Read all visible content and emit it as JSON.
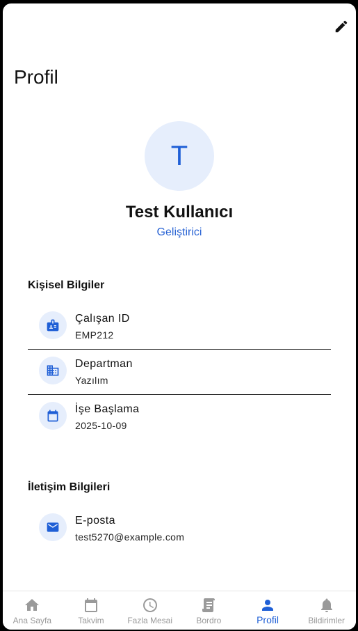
{
  "header": {
    "title": "Profil",
    "edit_icon": "pencil-icon"
  },
  "profile": {
    "avatar_initial": "T",
    "name": "Test Kullanıcı",
    "role": "Geliştirici"
  },
  "personal": {
    "section_title": "Kişisel Bilgiler",
    "items": [
      {
        "icon": "badge-icon",
        "label": "Çalışan ID",
        "value": "EMP212"
      },
      {
        "icon": "building-icon",
        "label": "Departman",
        "value": "Yazılım"
      },
      {
        "icon": "calendar-icon",
        "label": "İşe Başlama",
        "value": "2025-10-09"
      }
    ]
  },
  "contact": {
    "section_title": "İletişim Bilgileri",
    "items": [
      {
        "icon": "mail-icon",
        "label": "E-posta",
        "value": "test5270@example.com"
      }
    ]
  },
  "nav": {
    "items": [
      {
        "icon": "home-icon",
        "label": "Ana Sayfa",
        "active": false
      },
      {
        "icon": "calendar-icon",
        "label": "Takvim",
        "active": false
      },
      {
        "icon": "clock-icon",
        "label": "Fazla Mesai",
        "active": false
      },
      {
        "icon": "receipt-icon",
        "label": "Bordro",
        "active": false
      },
      {
        "icon": "person-icon",
        "label": "Profil",
        "active": true
      },
      {
        "icon": "bell-icon",
        "label": "Bildirimler",
        "active": false
      }
    ]
  },
  "colors": {
    "accent": "#1f5fd6",
    "icon_bg": "#e6eefc",
    "inactive": "#9a9a9a"
  }
}
